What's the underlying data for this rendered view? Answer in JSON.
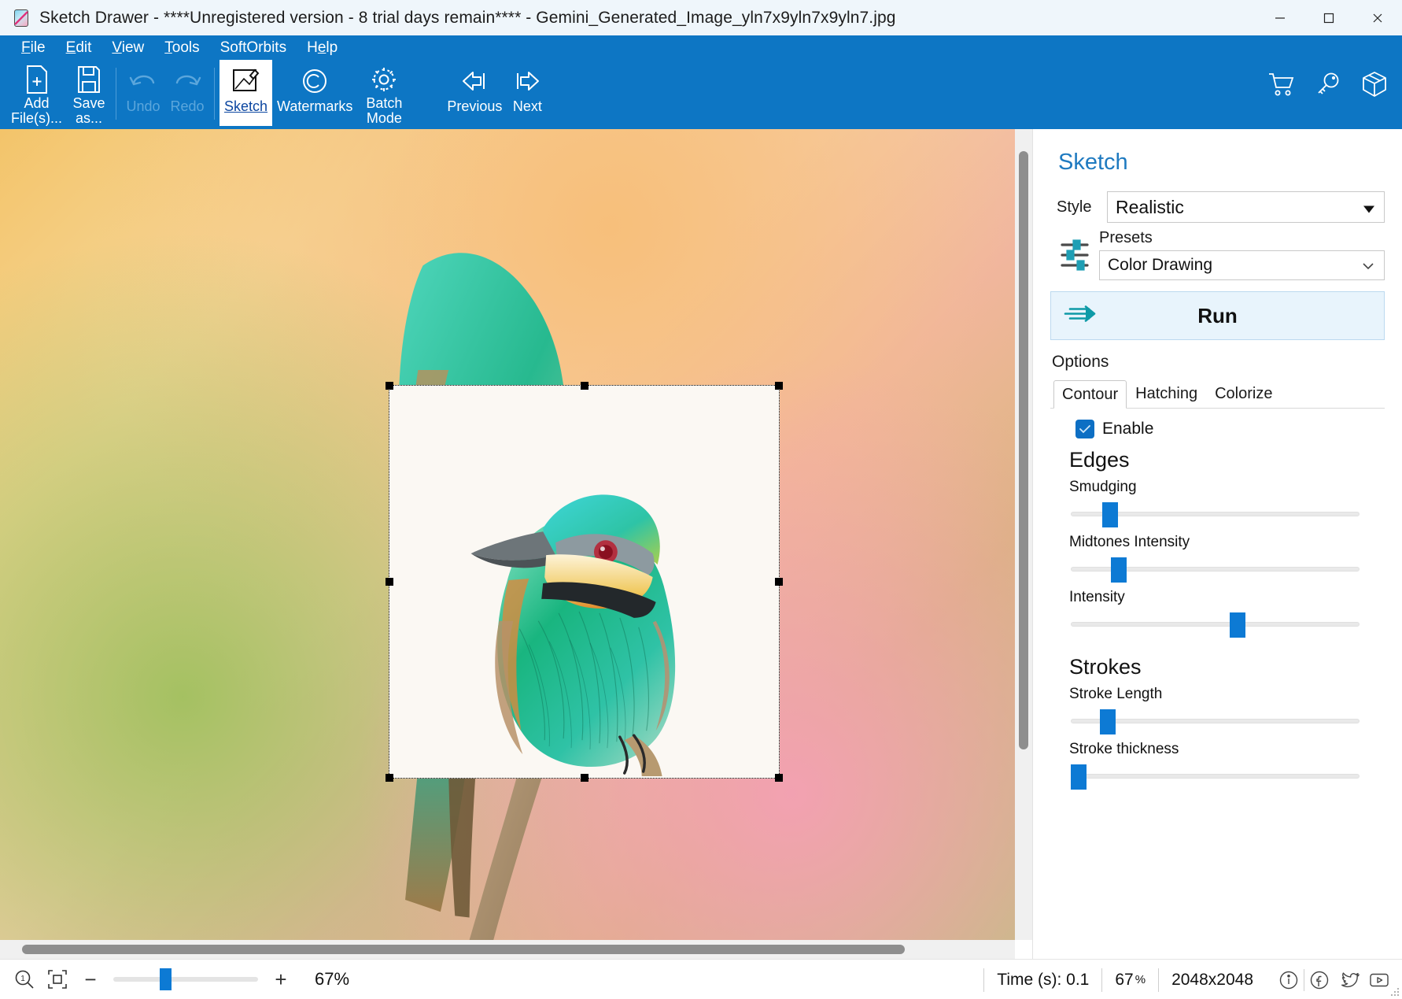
{
  "window": {
    "title": "Sketch Drawer - ****Unregistered version - 8 trial days remain**** - Gemini_Generated_Image_yln7x9yln7x9yln7.jpg",
    "minimize_label": "Minimize",
    "maximize_label": "Maximize",
    "close_label": "Close"
  },
  "menubar": {
    "items": [
      {
        "label": "File"
      },
      {
        "label": "Edit"
      },
      {
        "label": "View"
      },
      {
        "label": "Tools"
      },
      {
        "label": "SoftOrbits"
      },
      {
        "label": "Help"
      }
    ]
  },
  "toolbar": {
    "add_files": "Add\nFile(s)...",
    "save_as": "Save\nas...",
    "undo": "Undo",
    "redo": "Redo",
    "sketch": "Sketch",
    "watermarks": "Watermarks",
    "batch_mode": "Batch\nMode",
    "previous": "Previous",
    "next": "Next",
    "cart_icon": "shopping-cart-icon",
    "key_icon": "key-icon",
    "box_icon": "package-box-icon"
  },
  "panel": {
    "title": "Sketch",
    "style_label": "Style",
    "style_value": "Realistic",
    "presets_label": "Presets",
    "presets_value": "Color Drawing",
    "run_label": "Run",
    "options_label": "Options",
    "tabs": [
      {
        "label": "Contour",
        "active": true
      },
      {
        "label": "Hatching",
        "active": false
      },
      {
        "label": "Colorize",
        "active": false
      }
    ],
    "enable_label": "Enable",
    "enable_checked": true,
    "groups": [
      {
        "title": "Edges",
        "sliders": [
          {
            "label": "Smudging",
            "value": 11
          },
          {
            "label": "Midtones Intensity",
            "value": 14
          },
          {
            "label": "Intensity",
            "value": 55
          }
        ]
      },
      {
        "title": "Strokes",
        "sliders": [
          {
            "label": "Stroke Length",
            "value": 10
          },
          {
            "label": "Stroke thickness",
            "value": 0
          }
        ]
      }
    ]
  },
  "statusbar": {
    "zoom_info_icon": "zoom-info-icon",
    "fit_icon": "fit-to-screen-icon",
    "minus": "−",
    "plus": "+",
    "zoom_slider_value": 32,
    "zoom_percent": "67%",
    "time_label": "Time (s): 0.1",
    "zoom_percent_cell": "67",
    "zoom_percent_unit": "%",
    "dimensions": "2048x2048",
    "info_icon": "info-circle-icon",
    "facebook_icon": "facebook-icon",
    "twitter_icon": "twitter-bird-icon",
    "youtube_icon": "youtube-icon"
  },
  "colors": {
    "ribbon_blue": "#0d76c4",
    "accent_blue": "#0d7ad4",
    "panel_title_blue": "#1f7ac0",
    "run_bg": "#e8f4fc"
  }
}
